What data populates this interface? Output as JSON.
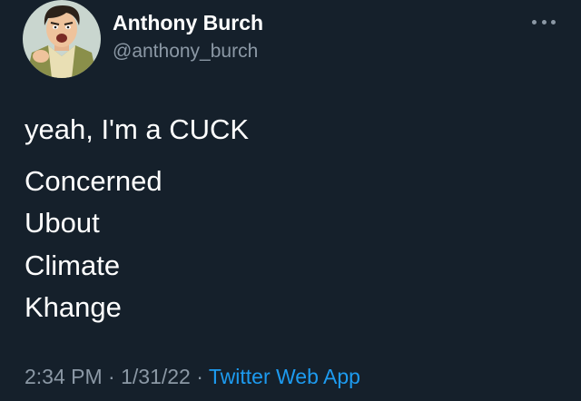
{
  "author": {
    "display_name": "Anthony Burch",
    "handle": "@anthony_burch",
    "avatar_icon": "cartoon-portrait-avatar"
  },
  "more_icon": "ellipsis-icon",
  "tweet": {
    "lines": [
      "yeah, I'm a CUCK",
      "Concerned",
      "Ubout",
      "Climate",
      "Khange"
    ]
  },
  "meta": {
    "time": "2:34 PM",
    "separator": " · ",
    "date": "1/31/22",
    "source": "Twitter Web App"
  },
  "colors": {
    "background": "#15202b",
    "text": "#ffffff",
    "secondary": "#8b98a5",
    "link": "#1d9bf0"
  }
}
